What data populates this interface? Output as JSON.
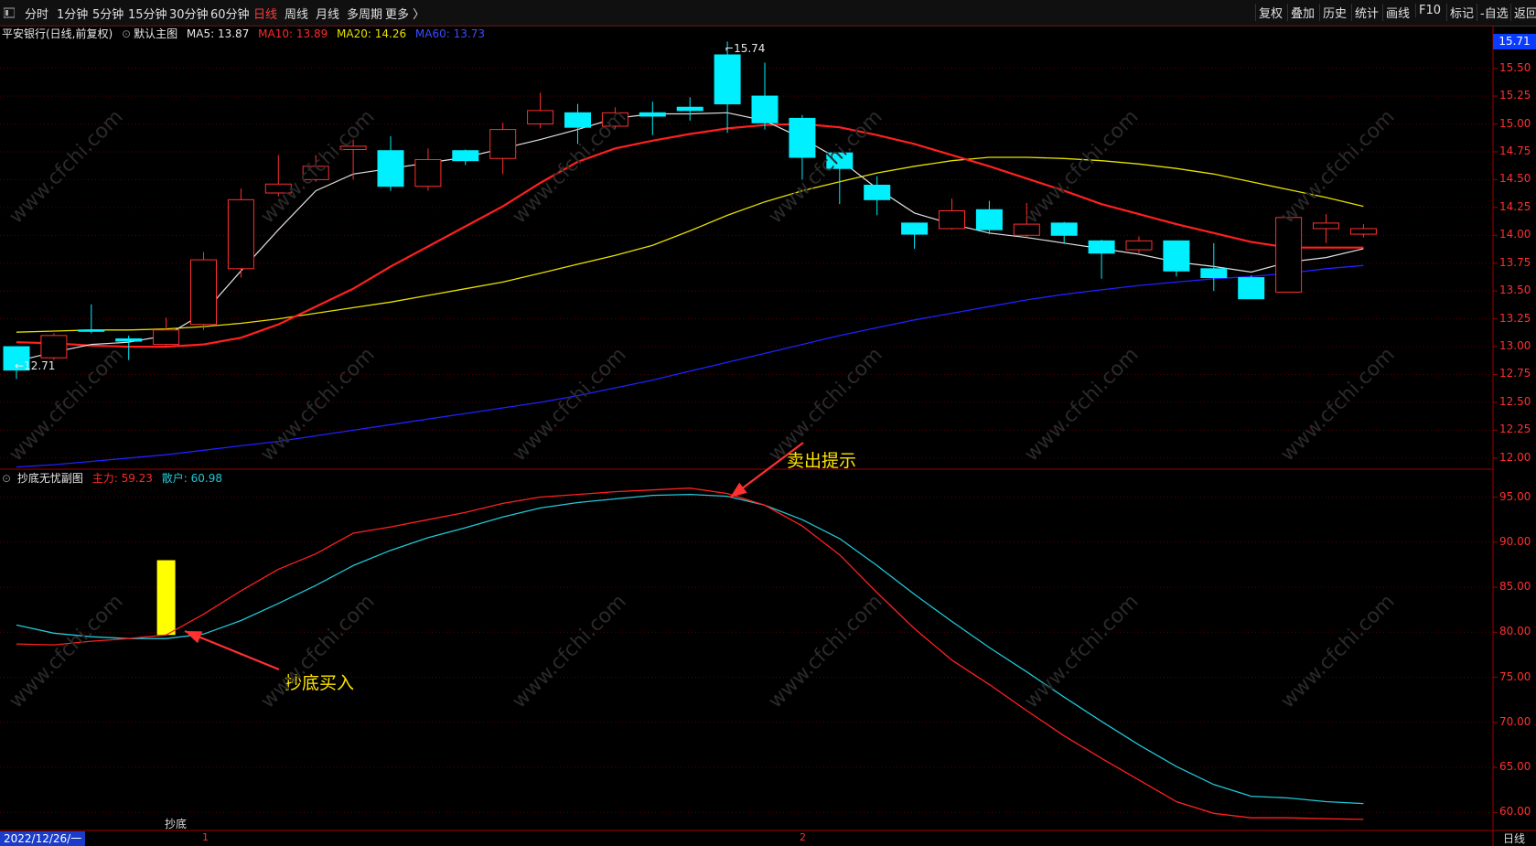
{
  "toolbar": {
    "left_items": [
      {
        "label": "分时",
        "active": false
      },
      {
        "label": "1分钟",
        "active": false
      },
      {
        "label": "5分钟",
        "active": false
      },
      {
        "label": "15分钟",
        "active": false
      },
      {
        "label": "30分钟",
        "active": false
      },
      {
        "label": "60分钟",
        "active": false
      },
      {
        "label": "日线",
        "active": true
      },
      {
        "label": "周线",
        "active": false
      },
      {
        "label": "月线",
        "active": false
      },
      {
        "label": "多周期",
        "active": false
      },
      {
        "label": "更多 〉",
        "active": false
      }
    ],
    "right_items": [
      "复权",
      "叠加",
      "历史",
      "统计",
      "画线",
      "F10",
      "标记",
      "-自选",
      "返回"
    ]
  },
  "main_panel": {
    "stock_name": "平安银行(日线,前复权)",
    "main_chart_label": "默认主图",
    "ma5": "MA5: 13.87",
    "ma10": "MA10: 13.89",
    "ma20": "MA20: 14.26",
    "ma60": "MA60: 13.73",
    "max_label": "15.74",
    "min_label": "12.71",
    "current_price": "15.71",
    "y_labels": [
      "15.50",
      "15.25",
      "15.00",
      "14.75",
      "14.50",
      "14.25",
      "14.00",
      "13.75",
      "13.50",
      "13.25",
      "13.00",
      "12.75",
      "12.50",
      "12.25",
      "12.00"
    ]
  },
  "sub_panel": {
    "name": "抄底无忧副图",
    "main_force": "主力: 59.23",
    "retail": "散户: 60.98",
    "y_labels": [
      "95.00",
      "90.00",
      "85.00",
      "80.00",
      "75.00",
      "70.00",
      "65.00",
      "60.00"
    ],
    "signal_label": "抄底"
  },
  "annotations": {
    "sell": "卖出提示",
    "buy": "抄底买入"
  },
  "bottom_bar": {
    "date": "2022/12/26/一",
    "marks": [
      "1",
      "2"
    ],
    "period": "日线"
  },
  "watermark": "www.cfchi.com",
  "colors": {
    "up": "#ff3030",
    "down": "#00f0ff",
    "ma5": "#e0e0e0",
    "ma10": "#ff2020",
    "ma20": "#e8e000",
    "ma60": "#2020ff",
    "main_force": "#ff2020",
    "retail": "#20c8d8",
    "signal": "#ffff00",
    "grid": "#5a0000"
  },
  "chart_data": [
    {
      "type": "candlestick",
      "title": "平安银行(日线,前复权)",
      "ylim": [
        11.9,
        15.85
      ],
      "candles": [
        {
          "o": 13.0,
          "h": 13.0,
          "l": 12.71,
          "c": 12.79
        },
        {
          "o": 12.9,
          "h": 13.12,
          "l": 12.88,
          "c": 13.1
        },
        {
          "o": 13.15,
          "h": 13.38,
          "l": 13.12,
          "c": 13.14
        },
        {
          "o": 13.07,
          "h": 13.1,
          "l": 12.88,
          "c": 13.05
        },
        {
          "o": 13.02,
          "h": 13.26,
          "l": 13.0,
          "c": 13.15
        },
        {
          "o": 13.2,
          "h": 13.85,
          "l": 13.15,
          "c": 13.78
        },
        {
          "o": 13.7,
          "h": 14.42,
          "l": 13.62,
          "c": 14.32
        },
        {
          "o": 14.38,
          "h": 14.72,
          "l": 14.35,
          "c": 14.46
        },
        {
          "o": 14.5,
          "h": 14.72,
          "l": 14.48,
          "c": 14.62
        },
        {
          "o": 14.77,
          "h": 14.86,
          "l": 14.5,
          "c": 14.8
        },
        {
          "o": 14.76,
          "h": 14.89,
          "l": 14.4,
          "c": 14.44
        },
        {
          "o": 14.44,
          "h": 14.78,
          "l": 14.4,
          "c": 14.68
        },
        {
          "o": 14.76,
          "h": 14.77,
          "l": 14.63,
          "c": 14.67
        },
        {
          "o": 14.69,
          "h": 15.01,
          "l": 14.55,
          "c": 14.95
        },
        {
          "o": 15.0,
          "h": 15.28,
          "l": 14.96,
          "c": 15.12
        },
        {
          "o": 15.1,
          "h": 15.18,
          "l": 14.82,
          "c": 14.97
        },
        {
          "o": 14.98,
          "h": 15.15,
          "l": 14.95,
          "c": 15.1
        },
        {
          "o": 15.1,
          "h": 15.2,
          "l": 14.9,
          "c": 15.07
        },
        {
          "o": 15.15,
          "h": 15.24,
          "l": 15.03,
          "c": 15.12
        },
        {
          "o": 15.62,
          "h": 15.74,
          "l": 14.92,
          "c": 15.18
        },
        {
          "o": 15.25,
          "h": 15.55,
          "l": 14.95,
          "c": 15.01
        },
        {
          "o": 15.05,
          "h": 15.08,
          "l": 14.5,
          "c": 14.7
        },
        {
          "o": 14.74,
          "h": 14.74,
          "l": 14.28,
          "c": 14.6
        },
        {
          "o": 14.45,
          "h": 14.53,
          "l": 14.18,
          "c": 14.32
        },
        {
          "o": 14.11,
          "h": 14.11,
          "l": 13.88,
          "c": 14.01
        },
        {
          "o": 14.06,
          "h": 14.33,
          "l": 14.05,
          "c": 14.22
        },
        {
          "o": 14.23,
          "h": 14.31,
          "l": 14.01,
          "c": 14.05
        },
        {
          "o": 14.0,
          "h": 14.29,
          "l": 13.98,
          "c": 14.1
        },
        {
          "o": 14.11,
          "h": 14.12,
          "l": 13.93,
          "c": 14.0
        },
        {
          "o": 13.95,
          "h": 13.96,
          "l": 13.61,
          "c": 13.84
        },
        {
          "o": 13.87,
          "h": 13.99,
          "l": 13.84,
          "c": 13.95
        },
        {
          "o": 13.95,
          "h": 13.95,
          "l": 13.63,
          "c": 13.68
        },
        {
          "o": 13.7,
          "h": 13.93,
          "l": 13.5,
          "c": 13.62
        },
        {
          "o": 13.62,
          "h": 13.64,
          "l": 13.43,
          "c": 13.43
        },
        {
          "o": 13.49,
          "h": 14.16,
          "l": 13.49,
          "c": 14.16
        },
        {
          "o": 14.06,
          "h": 14.19,
          "l": 13.93,
          "c": 14.11
        },
        {
          "o": 14.01,
          "h": 14.1,
          "l": 13.98,
          "c": 14.06
        }
      ],
      "ma5": [
        12.87,
        12.95,
        13.02,
        13.04,
        13.1,
        13.3,
        13.68,
        14.05,
        14.4,
        14.55,
        14.6,
        14.65,
        14.7,
        14.78,
        14.86,
        14.95,
        15.05,
        15.09,
        15.09,
        15.1,
        15.03,
        14.87,
        14.68,
        14.42,
        14.2,
        14.1,
        14.02,
        13.98,
        13.93,
        13.88,
        13.83,
        13.76,
        13.72,
        13.67,
        13.76,
        13.8,
        13.88
      ],
      "ma10": [
        13.04,
        13.03,
        13.01,
        13.0,
        13.0,
        13.02,
        13.08,
        13.2,
        13.36,
        13.52,
        13.72,
        13.9,
        14.08,
        14.26,
        14.47,
        14.66,
        14.78,
        14.85,
        14.91,
        14.96,
        14.99,
        15.0,
        14.97,
        14.9,
        14.82,
        14.72,
        14.62,
        14.51,
        14.4,
        14.28,
        14.19,
        14.1,
        14.02,
        13.94,
        13.89,
        13.89,
        13.89
      ],
      "ma20": [
        13.13,
        13.14,
        13.15,
        13.15,
        13.16,
        13.18,
        13.21,
        13.25,
        13.3,
        13.35,
        13.4,
        13.46,
        13.52,
        13.58,
        13.66,
        13.74,
        13.82,
        13.91,
        14.04,
        14.18,
        14.3,
        14.4,
        14.48,
        14.56,
        14.62,
        14.67,
        14.7,
        14.7,
        14.69,
        14.67,
        14.64,
        14.6,
        14.55,
        14.48,
        14.41,
        14.34,
        14.26
      ],
      "ma60": [
        11.92,
        11.94,
        11.97,
        12.0,
        12.03,
        12.07,
        12.11,
        12.15,
        12.2,
        12.25,
        12.3,
        12.35,
        12.4,
        12.45,
        12.5,
        12.56,
        12.63,
        12.7,
        12.78,
        12.86,
        12.94,
        13.02,
        13.1,
        13.17,
        13.24,
        13.3,
        13.36,
        13.42,
        13.47,
        13.51,
        13.55,
        13.58,
        13.61,
        13.63,
        13.66,
        13.7,
        13.73
      ]
    },
    {
      "type": "line",
      "title": "抄底无忧副图",
      "ylim": [
        58,
        98
      ],
      "series": [
        {
          "name": "主力",
          "values": [
            78.7,
            78.6,
            79.0,
            79.3,
            79.7,
            82.0,
            84.6,
            87.0,
            88.7,
            91.0,
            91.7,
            92.5,
            93.3,
            94.3,
            95.0,
            95.3,
            95.6,
            95.8,
            96.0,
            95.4,
            94.1,
            91.8,
            88.6,
            84.4,
            80.4,
            76.9,
            74.2,
            71.3,
            68.5,
            66.0,
            63.6,
            61.2,
            59.9,
            59.4,
            59.4,
            59.3,
            59.23
          ]
        },
        {
          "name": "散户",
          "values": [
            80.8,
            79.9,
            79.5,
            79.3,
            79.3,
            79.8,
            81.3,
            83.2,
            85.2,
            87.4,
            89.1,
            90.5,
            91.6,
            92.8,
            93.8,
            94.4,
            94.8,
            95.2,
            95.3,
            95.1,
            94.1,
            92.5,
            90.4,
            87.4,
            84.2,
            81.2,
            78.3,
            75.6,
            72.8,
            70.1,
            67.5,
            65.1,
            63.1,
            61.8,
            61.6,
            61.2,
            60.98
          ]
        }
      ],
      "signal_bar": {
        "index": 4,
        "from": 79.7,
        "to": 88.0
      }
    }
  ]
}
